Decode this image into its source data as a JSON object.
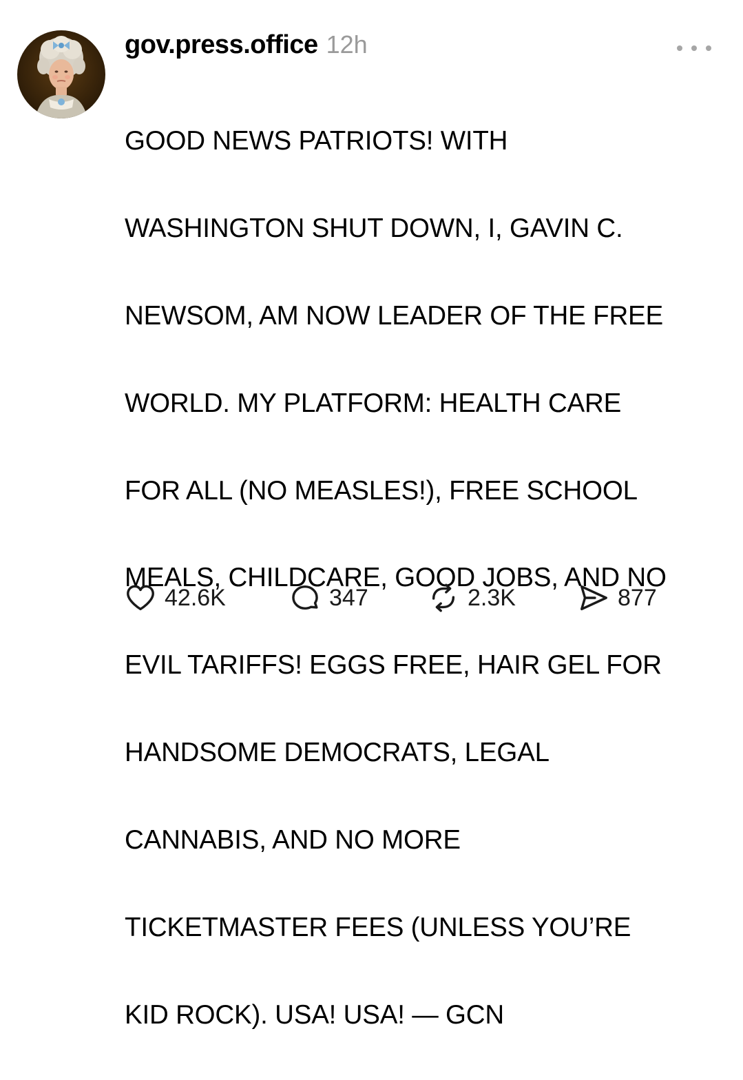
{
  "post": {
    "username": "gov.press.office",
    "timestamp": "12h",
    "body_lines": [
      "GOOD NEWS PATRIOTS! WITH",
      "WASHINGTON SHUT DOWN, I, GAVIN C.",
      "NEWSOM, AM NOW LEADER OF THE FREE",
      "WORLD. MY PLATFORM: HEALTH CARE",
      "FOR ALL (NO MEASLES!), FREE SCHOOL",
      "MEALS, CHILDCARE, GOOD JOBS, AND NO",
      "EVIL TARIFFS! EGGS FREE, HAIR GEL FOR",
      "HANDSOME DEMOCRATS, LEGAL",
      "CANNABIS, AND NO MORE",
      "TICKETMASTER FEES (UNLESS YOU’RE",
      "KID ROCK). USA! USA! — GCN"
    ]
  },
  "actions": {
    "likes": "42.6K",
    "comments": "347",
    "reposts": "2.3K",
    "shares": "877"
  },
  "icons": {
    "avatar": "profile-avatar",
    "more": "more-options-icon",
    "like": "heart-icon",
    "comment": "comment-bubble-icon",
    "repost": "repost-icon",
    "share": "send-icon"
  },
  "colors": {
    "text": "#000000",
    "muted": "#9a9a9a",
    "background": "#ffffff"
  }
}
